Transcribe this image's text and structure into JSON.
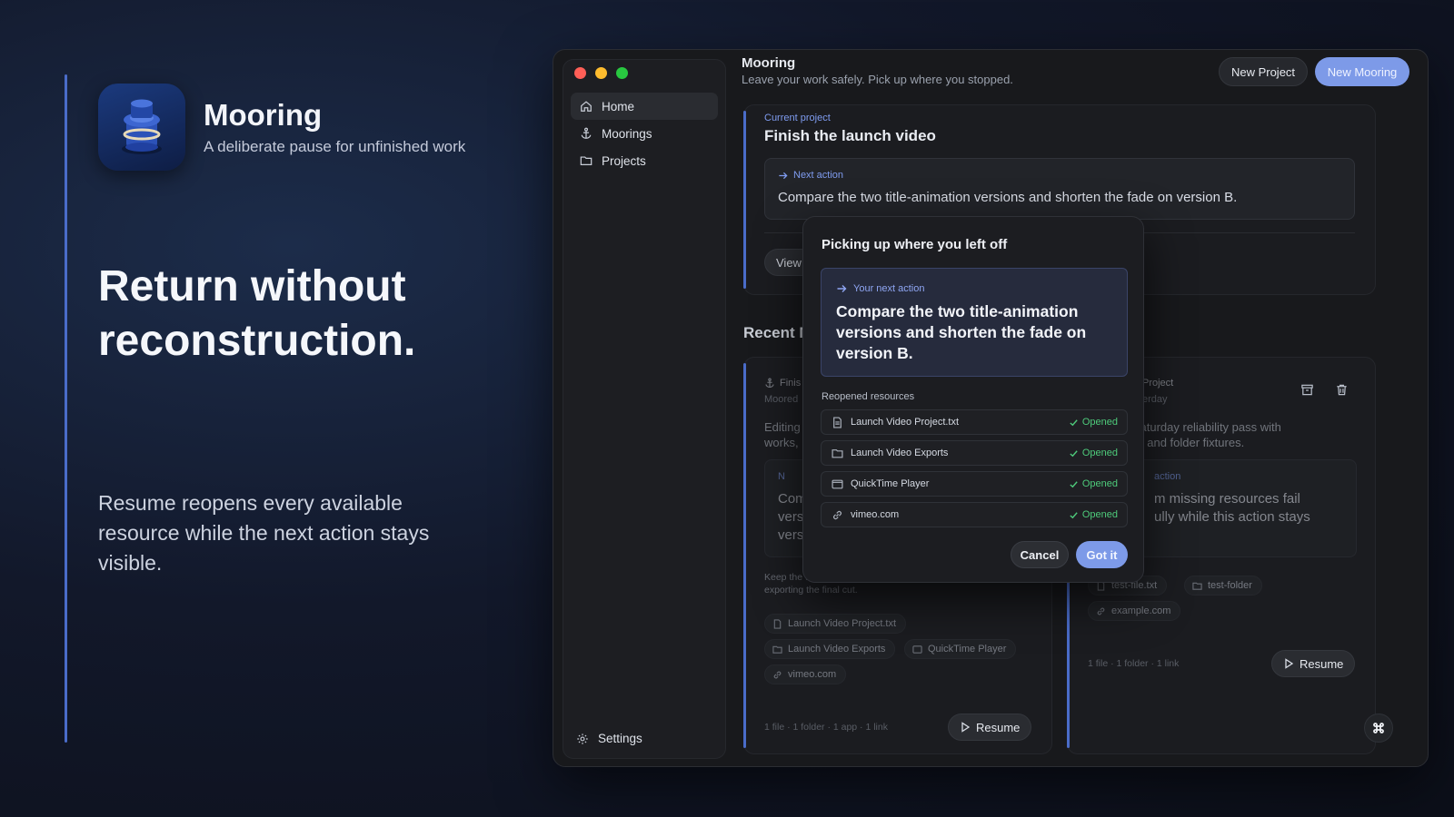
{
  "brand": {
    "name": "Mooring",
    "tagline": "A deliberate pause for unfinished work"
  },
  "hero": {
    "title": "Return without reconstruction.",
    "body": "Resume reopens every available resource while the next action stays visible."
  },
  "colors": {
    "accent": "#4a6cc9",
    "primary_button": "#7d9ae8",
    "success": "#4ecb7b"
  },
  "window": {
    "sidebar": {
      "items": [
        {
          "label": "Home",
          "icon": "home-icon",
          "active": true
        },
        {
          "label": "Moorings",
          "icon": "anchor-icon",
          "active": false
        },
        {
          "label": "Projects",
          "icon": "folder-icon",
          "active": false
        }
      ],
      "settings_label": "Settings"
    },
    "header": {
      "title": "Mooring",
      "subtitle": "Leave your work safely. Pick up where you stopped.",
      "new_project_label": "New Project",
      "new_mooring_label": "New Mooring"
    },
    "current": {
      "label": "Current project",
      "title": "Finish the launch video",
      "next_label": "Next action",
      "next_text": "Compare the two title-animation versions and shorten the fade on version B.",
      "view_label": "View"
    },
    "recent": {
      "heading": "Recent M",
      "left": {
        "title_partial": "Finis",
        "meta_partial": "Moored",
        "desc_partial_1": "Editing",
        "desc_partial_2": "works,",
        "next_label_partial": "N",
        "next_text_partial_1": "Com",
        "next_text_partial_2": "vers",
        "next_text_partial_3": "vers",
        "note_partial_1": "Keep the t",
        "note_partial_2": "exporting the final cut.",
        "chips": [
          "Launch Video Project.txt",
          "Launch Video Exports",
          "QuickTime Player",
          "vimeo.com"
        ],
        "summary": "1 file · 1 folder · 1 app · 1 link",
        "resume_label": "Resume"
      },
      "right": {
        "title_partial": "Project",
        "meta_partial": "erday",
        "desc_partial_1": "e Saturday reliability pass with",
        "desc_partial_2": "file and folder fixtures.",
        "next_label_partial": "action",
        "next_text_partial_1": "m missing resources fail",
        "next_text_partial_2": "ully while this action stays",
        "chips": [
          "test-file.txt",
          "test-folder",
          "example.com"
        ],
        "summary": "1 file · 1 folder · 1 link",
        "resume_label": "Resume"
      }
    },
    "modal": {
      "title": "Picking up where you left off",
      "next_label": "Your next action",
      "next_text": "Compare the two title-animation versions and shorten the fade on version B.",
      "resources_label": "Reopened resources",
      "resources": [
        {
          "name": "Launch Video Project.txt",
          "icon": "file-icon",
          "status": "Opened"
        },
        {
          "name": "Launch Video Exports",
          "icon": "folder-icon",
          "status": "Opened"
        },
        {
          "name": "QuickTime Player",
          "icon": "app-window-icon",
          "status": "Opened"
        },
        {
          "name": "vimeo.com",
          "icon": "link-icon",
          "status": "Opened"
        }
      ],
      "cancel_label": "Cancel",
      "confirm_label": "Got it"
    }
  }
}
